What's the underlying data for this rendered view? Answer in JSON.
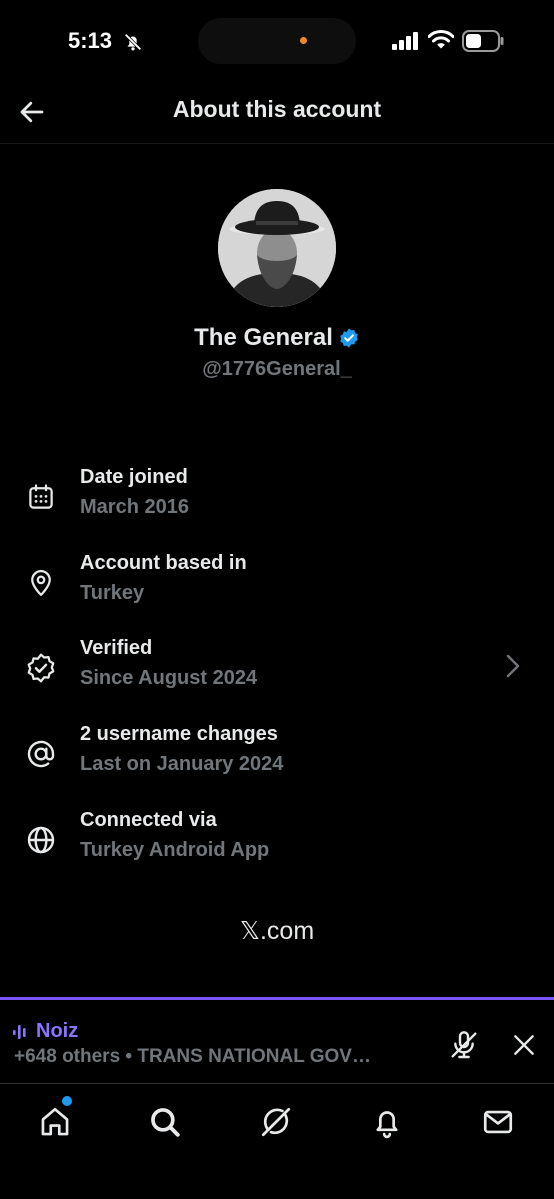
{
  "status_bar": {
    "time": "5:13",
    "icons": [
      "bell-slash-icon",
      "signal-icon",
      "wifi-icon",
      "battery-icon"
    ]
  },
  "header": {
    "title": "About this account",
    "back_icon": "arrow-left-icon"
  },
  "profile": {
    "display_name": "The General",
    "handle": "@1776General_",
    "verified_color": "#1d9bf0"
  },
  "info": [
    {
      "icon": "calendar-icon",
      "title": "Date joined",
      "subtitle": "March 2016"
    },
    {
      "icon": "location-pin-icon",
      "title": "Account based in",
      "subtitle": "Turkey"
    },
    {
      "icon": "verified-badge-icon",
      "title": "Verified",
      "subtitle": "Since August 2024"
    },
    {
      "icon": "at-sign-icon",
      "title": "2 username changes",
      "subtitle": "Last on January 2024"
    },
    {
      "icon": "globe-icon",
      "title": "Connected via",
      "subtitle": "Turkey Android App"
    }
  ],
  "footer_link": "𝕏.com",
  "space": {
    "name": "Noiz",
    "subtitle": "+648 others • TRANS NATIONAL GOV…",
    "accent": "#7856ff"
  },
  "nav": [
    "home-icon",
    "search-icon",
    "grok-icon",
    "notifications-icon",
    "messages-icon"
  ],
  "colors": {
    "background": "#000000",
    "text_primary": "#e7e9ea",
    "text_secondary": "#71767b"
  }
}
